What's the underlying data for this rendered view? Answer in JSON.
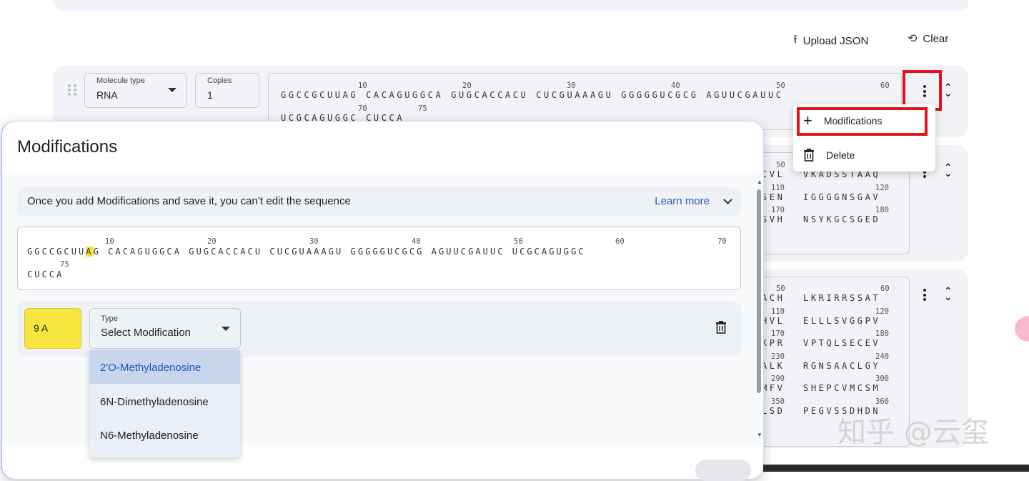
{
  "toolbar": {
    "upload_label": "Upload JSON",
    "clear_label": "Clear"
  },
  "entity1": {
    "molecule_type_label": "Molecule type",
    "molecule_type_value": "RNA",
    "copies_label": "Copies",
    "copies_value": "1",
    "seq_line1": "GGCCGCUUAG CACAGUGGCA GUGCACCACU CUCGUAAAGU GGGGGUCGCG AGUUCGAUUC",
    "seq_line2": "UCGCAGUGGC CUCCA",
    "idx": [
      "10",
      "20",
      "30",
      "40",
      "50",
      "60",
      "70",
      "75"
    ]
  },
  "menu": {
    "modifications_label": "Modifications",
    "delete_label": "Delete"
  },
  "entity2": {
    "rows": [
      {
        "idx_a": "50",
        "left": "CVL",
        "right": "VKADSSTAAQ",
        "idx_b": ""
      },
      {
        "idx_a": "110",
        "left": "SEN",
        "right": "IGGGGNSGAV",
        "idx_b": "120"
      },
      {
        "idx_a": "170",
        "left": "SVH",
        "right": "NSYKGCSGED",
        "idx_b": "180"
      }
    ]
  },
  "entity3": {
    "rows": [
      {
        "idx_a": "50",
        "left": "ACH",
        "right": "LKRIRRSSAT",
        "idx_b": "60"
      },
      {
        "idx_a": "110",
        "left": "HVL",
        "right": "ELLLSVGGPV",
        "idx_b": "120"
      },
      {
        "idx_a": "170",
        "left": "KPR",
        "right": "VPTQLSECEV",
        "idx_b": "180"
      },
      {
        "idx_a": "230",
        "left": "ALK",
        "right": "RGNSAACLGY",
        "idx_b": "240"
      },
      {
        "idx_a": "290",
        "left": "MFV",
        "right": "SHEPCVMCSM",
        "idx_b": "300"
      },
      {
        "idx_a": "350",
        "left": "LSD",
        "right": "PEGVSSDHDN",
        "idx_b": "360"
      }
    ]
  },
  "modal": {
    "title": "Modifications",
    "info_text": "Once you add Modifications and save it, you can’t edit the sequence",
    "learn_more": "Learn more",
    "seq_pre": "GGCCGCUU",
    "seq_hl": "A",
    "seq_post": "G CACAGUGGCA GUGCACCACU CUCGUAAAGU GGGGGUCGCG AGUUCGAUUC UCGCAGUGGC",
    "seq_line2": "CUCCA",
    "idx": [
      "10",
      "20",
      "30",
      "40",
      "50",
      "60",
      "70",
      "75"
    ],
    "chip_label": "9 A",
    "type_label": "Type",
    "type_value": "Select Modification",
    "options": [
      "2'O-Methyladenosine",
      "6N-Dimethyladenosine",
      "N6-Methyladenosine"
    ]
  },
  "watermark": "知乎 @云玺",
  "colors": {
    "highlight": "#e8101a",
    "accent": "#2a56c6",
    "chip": "#f6e63f"
  }
}
